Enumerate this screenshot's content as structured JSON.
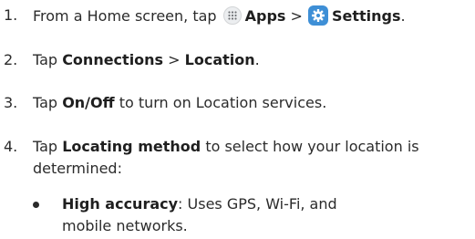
{
  "steps": [
    {
      "number": "1.",
      "before": "From a Home screen, tap",
      "apps_label": "Apps",
      "separator": ">",
      "settings_label": "Settings",
      "end": "."
    },
    {
      "number": "2.",
      "before": "Tap",
      "connections_label": "Connections",
      "separator": ">",
      "location_label": "Location",
      "end": "."
    },
    {
      "number": "3.",
      "before": "Tap",
      "onoff_label": "On/Off",
      "after": "to turn on Location services."
    },
    {
      "number": "4.",
      "before": "Tap",
      "locating_label": "Locating method",
      "after_line1": "to select how your location is",
      "after_line2": "determined:"
    }
  ],
  "bullets": [
    {
      "term": "High accuracy",
      "description": ": Uses GPS, Wi-Fi, and mobile networks."
    }
  ],
  "icons": {
    "apps": "apps-grid-icon",
    "settings": "settings-gear-icon"
  },
  "colors": {
    "text": "#2b2b2b",
    "settings_icon_bg": "#3e8fd6",
    "apps_icon_bg": "#eceef0"
  }
}
